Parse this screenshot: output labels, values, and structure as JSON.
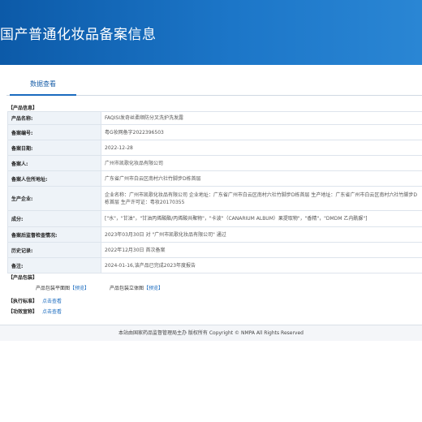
{
  "banner": {
    "title": "国产普通化妆品备案信息"
  },
  "tabs": [
    {
      "label": "数据查看"
    }
  ],
  "product_info": {
    "section_title": "【产品信息】",
    "rows": [
      {
        "label": "产品名称:",
        "value": "FAQISI发奇丝柔顺防分叉洗护洗发露"
      },
      {
        "label": "备案编号:",
        "value": "粤G妆网备字2022396503"
      },
      {
        "label": "备案日期:",
        "value": "2022-12-28"
      },
      {
        "label": "备案人:",
        "value": "广州市凯歌化妆品有限公司"
      },
      {
        "label": "备案人住所地址:",
        "value": "广东省广州市白云区南村六社竹脚步D栋首层"
      },
      {
        "label": "生产企业:",
        "value": "企业名称：广州市凯歌化妆品有限公司 企业地址：广东省广州市白云区南村六社竹脚步D栋首层 生产地址：广东省广州市白云区南村六社竹脚步D栋首层 生产许可证：粤妆20170355"
      },
      {
        "label": "成分:",
        "value": "[\"水\"，\"甘油\"，\"甘油丙烯酸酯/丙烯酸共聚物\"，\"卡波\"（CANARIUM ALBUM）果提取物\"，\"香精\"，\"DMDM 乙内酰脲\"]"
      },
      {
        "label": "备案后监督检查情况:",
        "value": "2023年03月30日 对 \"广州市凯歌化妆品有限公司\" 通过"
      },
      {
        "label": "历史记录:",
        "value": "2022年12月30日 首次备案"
      },
      {
        "label": "备注:",
        "value": "2024-01-16,该产品已完成2023年度报告"
      }
    ]
  },
  "packaging": {
    "section_title": "【产品包装】",
    "flat_label": "产品包装平面图",
    "stereo_label": "产品包装立体图",
    "preview_label": "【预览】"
  },
  "standard": {
    "label": "【执行标准】",
    "link": "点击查看"
  },
  "efficacy": {
    "label": "【功效宣称】",
    "link": "点击查看"
  },
  "footer": {
    "text": "本站由国家药品监督管理局主办 版权所有 Copyright © NMPA All Rights Reserved"
  }
}
